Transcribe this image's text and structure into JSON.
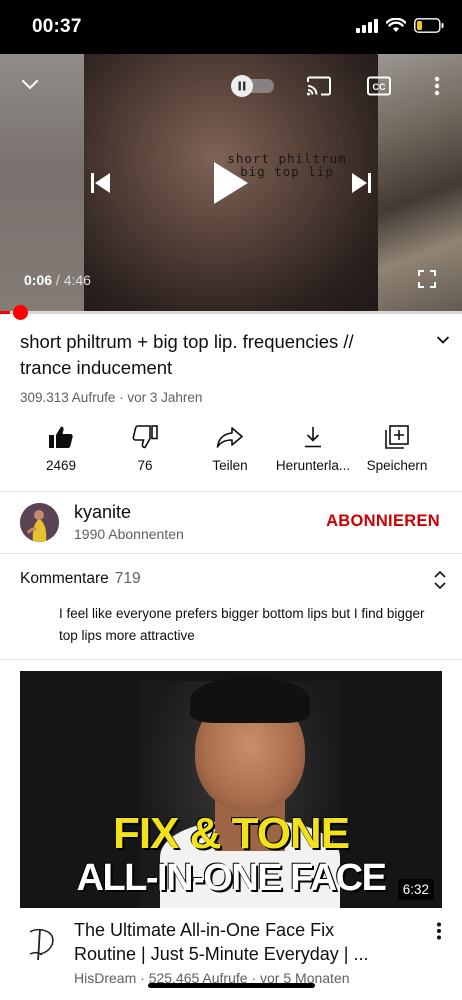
{
  "status_bar": {
    "time": "00:37"
  },
  "player": {
    "overlay_text_line1": "short philtrum",
    "overlay_text_line2": "big top lip",
    "current_time": "0:06",
    "separator": " / ",
    "duration": "4:46",
    "progress_fraction": 0.021,
    "is_playing": true
  },
  "video": {
    "title": "short philtrum + big top lip. frequencies // trance inducement",
    "views": "309.313 Aufrufe",
    "age": "vor 3 Jahren"
  },
  "actions": {
    "like_count": "2469",
    "dislike_count": "76",
    "share_label": "Teilen",
    "download_label": "Herunterla...",
    "save_label": "Speichern"
  },
  "channel": {
    "name": "kyanite",
    "subscribers": "1990 Abonnenten",
    "subscribe_label": "ABONNIEREN",
    "subscribe_color": "#cc0000"
  },
  "comments": {
    "heading": "Kommentare",
    "count": "719",
    "top_comment": "I feel like everyone prefers bigger bottom lips but I find bigger top lips more attractive"
  },
  "next_video": {
    "thumb_line1": "FIX & TONE",
    "thumb_line2": "ALL-IN-ONE FACE",
    "duration": "6:32",
    "title_line1": "The Ultimate All-in-One Face Fix",
    "title_line2": "Routine | Just 5-Minute Everyday | ...",
    "channel": "HisDream",
    "views": "525.465 Aufrufe",
    "age": "vor 5 Monaten"
  },
  "colors": {
    "accent_red": "#ff0000",
    "text_primary": "#0f0f0f",
    "text_secondary": "#606060"
  }
}
